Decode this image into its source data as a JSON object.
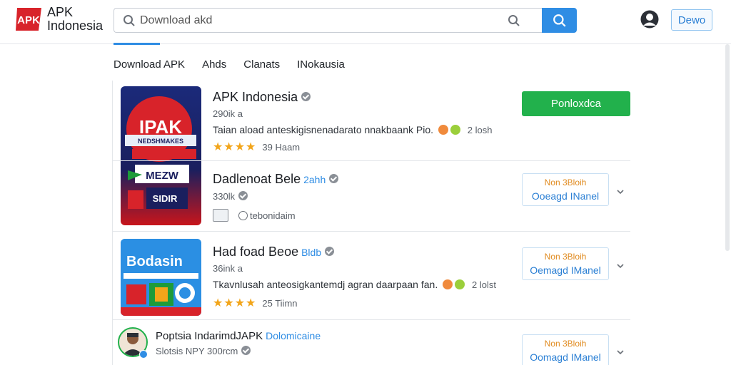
{
  "header": {
    "logo_mark": "APK",
    "logo_line1": "APK",
    "logo_line2": "Indonesia",
    "search_placeholder": "Download akd",
    "new_button": "Dewo"
  },
  "nav": [
    "Download APK",
    "Ahds",
    "Clanats",
    "INokausia"
  ],
  "apps": [
    {
      "title": "APK Indonesia",
      "size": "290ik a",
      "desc": "Taian aload anteskigisnenadarato nnakbaank Pio.",
      "desc_count": "2 losh",
      "rating_text": "39 Haam",
      "action": "Ponloxdca",
      "thumb_lines": [
        "IPAK",
        "NEDSHMAKES",
        "MEZW",
        "SIDIR"
      ]
    },
    {
      "title": "Dadlenoat Bele",
      "tag": "2ahh",
      "size": "330lk",
      "meta2": "tebonidaim",
      "action_line1": "Non 3Bloih",
      "action_line2": "Ooeagd INanel"
    },
    {
      "title": "Had foad Beoe",
      "tag": "Bldb",
      "size": "36ink a",
      "desc": "Tkavnlusah anteosigkantemdj agran daarpaan fan.",
      "desc_count": "2 lolst",
      "rating_text": "25 Tiimn",
      "action_line1": "Non 3Bloih",
      "action_line2": "Oemagd IManel",
      "thumb_text": "Bodasin"
    },
    {
      "title": "Poptsia IndarimdJAPK",
      "tag": "Dolomicaine",
      "size": "Slotsis NPY 300rcm",
      "action_line1": "Non 3Bloih",
      "action_line2": "Oomagd IManel"
    }
  ],
  "colors": {
    "accent": "#2f8de4",
    "green": "#22b14c",
    "star": "#f2a51a"
  }
}
